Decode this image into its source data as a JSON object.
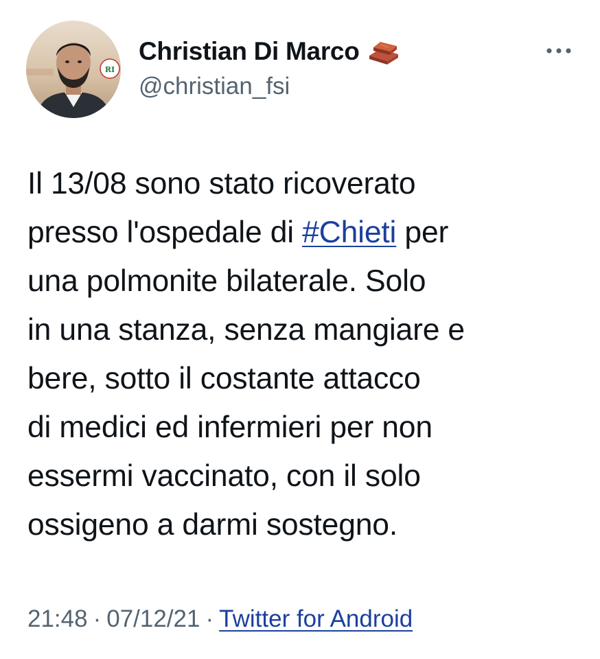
{
  "tweet": {
    "author": {
      "display_name": "Christian Di Marco",
      "handle": "@christian_fsi",
      "avatar_icon": "profile-photo",
      "name_emoji": "brick-icon"
    },
    "more_icon": "more-horizontal-icon",
    "text": {
      "line1": "Il 13/08 sono stato ricoverato",
      "line2_before": "presso l'ospedale di ",
      "hashtag": "#Chieti",
      "line2_after": " per",
      "line3": "una polmonite bilaterale. Solo",
      "line4": "in una stanza, senza mangiare e",
      "line5": "bere, sotto il costante attacco",
      "line6": "di medici ed infermieri per non",
      "line7": "essermi vaccinato, con il solo",
      "line8": "ossigeno a darmi sostegno."
    },
    "meta": {
      "time": "21:48",
      "separator": "·",
      "date": "07/12/21",
      "source": "Twitter for Android"
    }
  },
  "colors": {
    "text": "#0f1419",
    "secondary": "#536471",
    "link": "#1b3f9e"
  }
}
